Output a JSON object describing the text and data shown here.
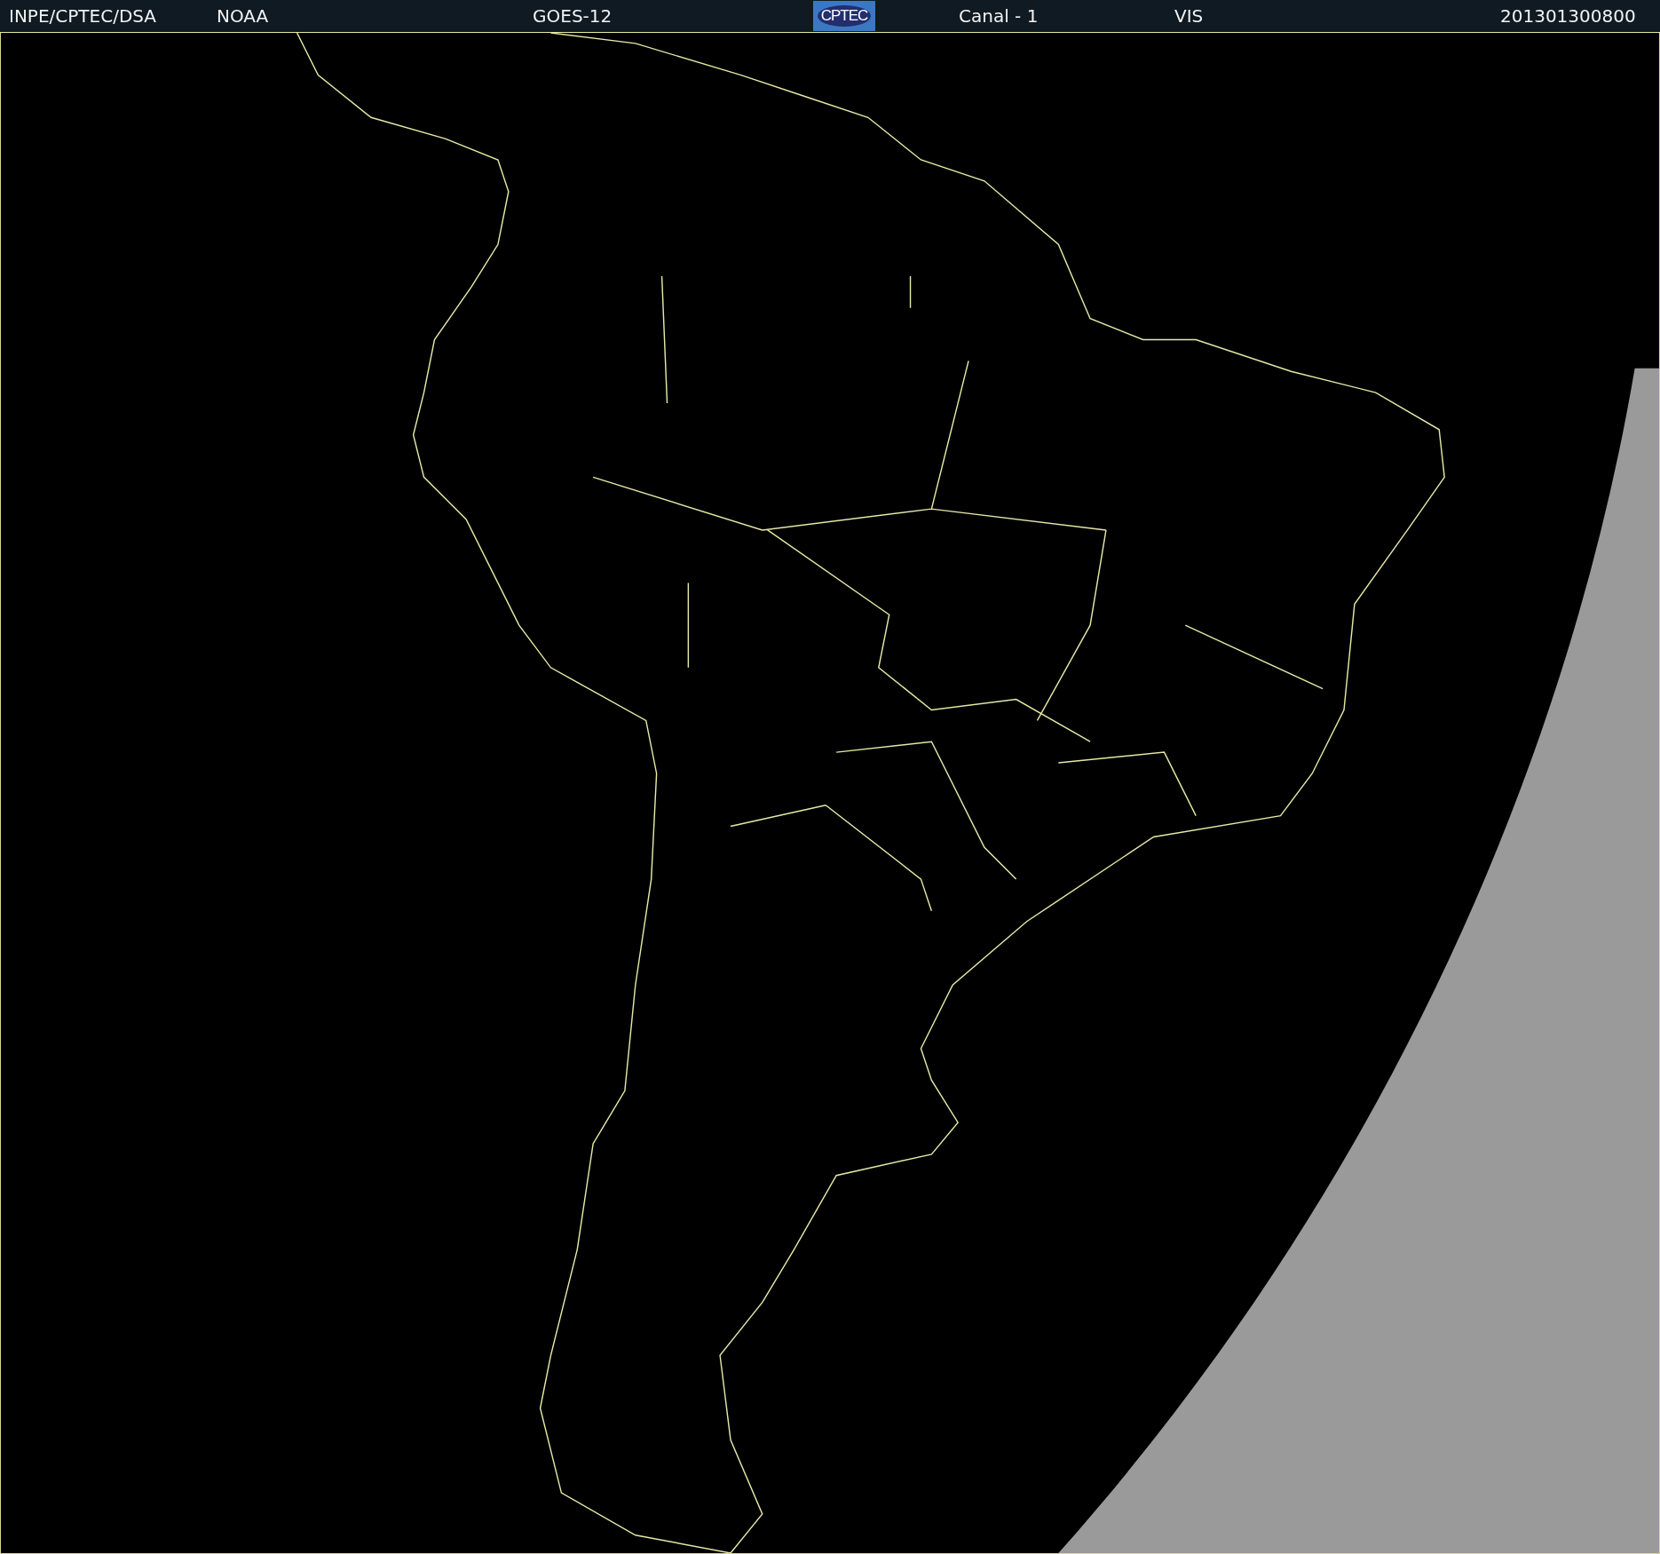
{
  "header": {
    "source": "INPE/CPTEC/DSA",
    "agency": "NOAA",
    "satellite": "GOES-12",
    "logo_text": "CPTEC",
    "channel": "Canal - 1",
    "band": "VIS",
    "timestamp": "201301300800"
  }
}
